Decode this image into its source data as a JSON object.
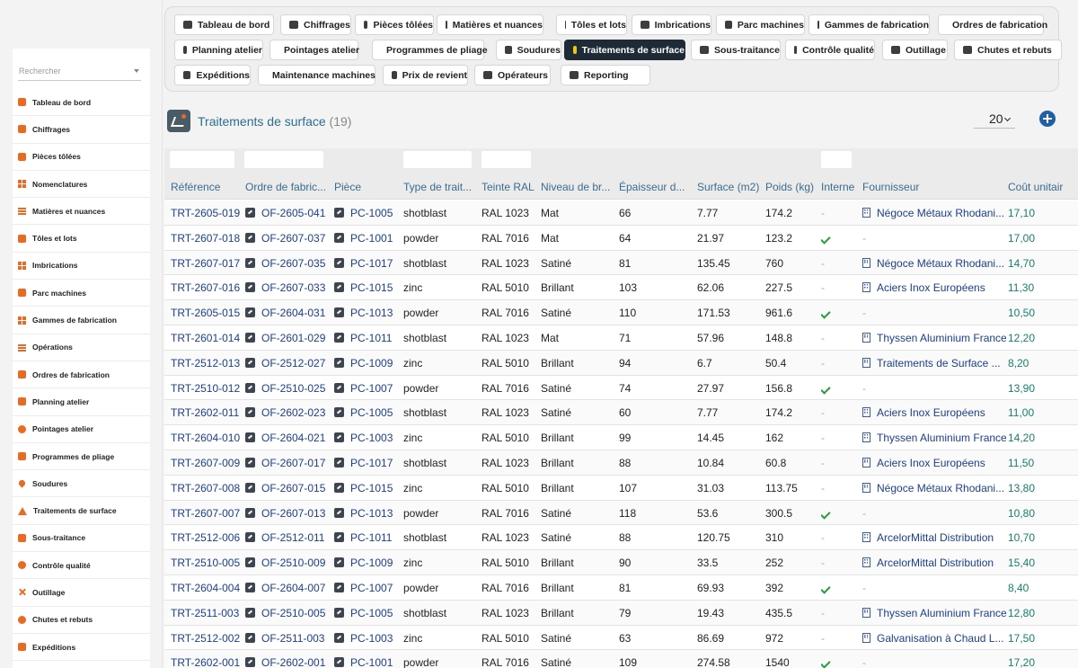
{
  "sidebar": {
    "search_placeholder": "Rechercher",
    "items": [
      {
        "label": "Tableau de bord",
        "icon": "dashboard-icon"
      },
      {
        "label": "Chiffrages",
        "icon": "calculator-icon"
      },
      {
        "label": "Pièces tôlées",
        "icon": "cube-icon"
      },
      {
        "label": "Nomenclatures",
        "icon": "sitemap-icon"
      },
      {
        "label": "Matières et nuances",
        "icon": "layers-icon"
      },
      {
        "label": "Tôles et lots",
        "icon": "stack-icon"
      },
      {
        "label": "Imbrications",
        "icon": "grid-icon"
      },
      {
        "label": "Parc machines",
        "icon": "factory-icon"
      },
      {
        "label": "Gammes de fabrication",
        "icon": "flow-icon"
      },
      {
        "label": "Opérations",
        "icon": "list-icon"
      },
      {
        "label": "Ordres de fabrication",
        "icon": "clipboard-icon"
      },
      {
        "label": "Planning atelier",
        "icon": "calendar-icon"
      },
      {
        "label": "Pointages atelier",
        "icon": "clock-icon"
      },
      {
        "label": "Programmes de pliage",
        "icon": "file-code-icon"
      },
      {
        "label": "Soudures",
        "icon": "flame-icon"
      },
      {
        "label": "Traitements de surface",
        "icon": "paint-roller-icon"
      },
      {
        "label": "Sous-traitance",
        "icon": "handshake-icon"
      },
      {
        "label": "Contrôle qualité",
        "icon": "badge-check-icon"
      },
      {
        "label": "Outillage",
        "icon": "tools-icon"
      },
      {
        "label": "Chutes et rebuts",
        "icon": "recycle-icon"
      },
      {
        "label": "Expéditions",
        "icon": "truck-icon"
      }
    ]
  },
  "tabs": [
    {
      "label": "Tableau de bord",
      "icon": "dashboard-icon",
      "active": false
    },
    {
      "label": "Chiffrages",
      "icon": "calculator-icon",
      "active": false
    },
    {
      "label": "Pièces tôlées",
      "icon": "cube-icon",
      "active": false
    },
    {
      "label": "Matières et nuances",
      "icon": "layers-icon",
      "active": false
    },
    {
      "label": "Tôles et lots",
      "icon": "stack-icon",
      "active": false
    },
    {
      "label": "Imbrications",
      "icon": "grid-icon",
      "active": false
    },
    {
      "label": "Parc machines",
      "icon": "factory-icon",
      "active": false
    },
    {
      "label": "Gammes de fabrication",
      "icon": "flow-icon",
      "active": false
    },
    {
      "label": "Ordres de fabrication",
      "icon": "clipboard-icon",
      "active": false
    },
    {
      "label": "Planning atelier",
      "icon": "calendar-icon",
      "active": false
    },
    {
      "label": "Pointages atelier",
      "icon": "clock-icon",
      "active": false
    },
    {
      "label": "Programmes de pliage",
      "icon": "file-code-icon",
      "active": false
    },
    {
      "label": "Soudures",
      "icon": "flame-icon",
      "active": false
    },
    {
      "label": "Traitements de surface",
      "icon": "paint-roller-icon",
      "active": true
    },
    {
      "label": "Sous-traitance",
      "icon": "handshake-icon",
      "active": false
    },
    {
      "label": "Contrôle qualité",
      "icon": "badge-check-icon",
      "active": false
    },
    {
      "label": "Outillage",
      "icon": "tools-icon",
      "active": false
    },
    {
      "label": "Chutes et rebuts",
      "icon": "recycle-icon",
      "active": false
    },
    {
      "label": "Expéditions",
      "icon": "truck-icon",
      "active": false
    },
    {
      "label": "Maintenance machines",
      "icon": "wrench-icon",
      "active": false
    },
    {
      "label": "Prix de revient",
      "icon": "receipt-icon",
      "active": false
    },
    {
      "label": "Opérateurs",
      "icon": "users-icon",
      "active": false
    },
    {
      "label": "Reporting",
      "icon": "chart-pie-icon",
      "active": false
    }
  ],
  "page": {
    "title": "Traitements de surface",
    "count": "(19)",
    "page_size": "20"
  },
  "table": {
    "columns": [
      "Référence",
      "Ordre de fabric...",
      "Pièce",
      "Type de trait...",
      "Teinte RAL",
      "Niveau de br...",
      "Épaisseur d...",
      "Surface (m2)",
      "Poids (kg)",
      "Interne",
      "Fournisseur",
      "Coût unitair"
    ],
    "rows": [
      {
        "ref": "TRT-2605-019",
        "of": "OF-2605-041",
        "piece": "PC-1005",
        "type": "shotblast",
        "ral": "RAL 1023",
        "niveau": "Mat",
        "ep": "66",
        "surface": "7.77",
        "poids": "174.2",
        "interne": false,
        "fournisseur": "Négoce Métaux Rhodani...",
        "cout": "17,10"
      },
      {
        "ref": "TRT-2607-018",
        "of": "OF-2607-037",
        "piece": "PC-1001",
        "type": "powder",
        "ral": "RAL 7016",
        "niveau": "Mat",
        "ep": "64",
        "surface": "21.97",
        "poids": "123.2",
        "interne": true,
        "fournisseur": "",
        "cout": "17,00"
      },
      {
        "ref": "TRT-2607-017",
        "of": "OF-2607-035",
        "piece": "PC-1017",
        "type": "shotblast",
        "ral": "RAL 1023",
        "niveau": "Satiné",
        "ep": "81",
        "surface": "135.45",
        "poids": "760",
        "interne": false,
        "fournisseur": "Négoce Métaux Rhodani...",
        "cout": "14,70"
      },
      {
        "ref": "TRT-2607-016",
        "of": "OF-2607-033",
        "piece": "PC-1015",
        "type": "zinc",
        "ral": "RAL 5010",
        "niveau": "Brillant",
        "ep": "103",
        "surface": "62.06",
        "poids": "227.5",
        "interne": false,
        "fournisseur": "Aciers Inox Européens",
        "cout": "11,30"
      },
      {
        "ref": "TRT-2605-015",
        "of": "OF-2604-031",
        "piece": "PC-1013",
        "type": "powder",
        "ral": "RAL 7016",
        "niveau": "Satiné",
        "ep": "110",
        "surface": "171.53",
        "poids": "961.6",
        "interne": true,
        "fournisseur": "",
        "cout": "10,50"
      },
      {
        "ref": "TRT-2601-014",
        "of": "OF-2601-029",
        "piece": "PC-1011",
        "type": "shotblast",
        "ral": "RAL 1023",
        "niveau": "Mat",
        "ep": "71",
        "surface": "57.96",
        "poids": "148.8",
        "interne": false,
        "fournisseur": "Thyssen Aluminium France",
        "cout": "12,20"
      },
      {
        "ref": "TRT-2512-013",
        "of": "OF-2512-027",
        "piece": "PC-1009",
        "type": "zinc",
        "ral": "RAL 5010",
        "niveau": "Brillant",
        "ep": "94",
        "surface": "6.7",
        "poids": "50.4",
        "interne": false,
        "fournisseur": "Traitements de Surface ...",
        "cout": "8,20"
      },
      {
        "ref": "TRT-2510-012",
        "of": "OF-2510-025",
        "piece": "PC-1007",
        "type": "powder",
        "ral": "RAL 7016",
        "niveau": "Satiné",
        "ep": "74",
        "surface": "27.97",
        "poids": "156.8",
        "interne": true,
        "fournisseur": "",
        "cout": "13,90"
      },
      {
        "ref": "TRT-2602-011",
        "of": "OF-2602-023",
        "piece": "PC-1005",
        "type": "shotblast",
        "ral": "RAL 1023",
        "niveau": "Satiné",
        "ep": "60",
        "surface": "7.77",
        "poids": "174.2",
        "interne": false,
        "fournisseur": "Aciers Inox Européens",
        "cout": "11,00"
      },
      {
        "ref": "TRT-2604-010",
        "of": "OF-2604-021",
        "piece": "PC-1003",
        "type": "zinc",
        "ral": "RAL 5010",
        "niveau": "Brillant",
        "ep": "99",
        "surface": "14.45",
        "poids": "162",
        "interne": false,
        "fournisseur": "Thyssen Aluminium France",
        "cout": "14,20"
      },
      {
        "ref": "TRT-2607-009",
        "of": "OF-2607-017",
        "piece": "PC-1017",
        "type": "shotblast",
        "ral": "RAL 1023",
        "niveau": "Brillant",
        "ep": "88",
        "surface": "10.84",
        "poids": "60.8",
        "interne": false,
        "fournisseur": "Aciers Inox Européens",
        "cout": "11,50"
      },
      {
        "ref": "TRT-2607-008",
        "of": "OF-2607-015",
        "piece": "PC-1015",
        "type": "zinc",
        "ral": "RAL 5010",
        "niveau": "Brillant",
        "ep": "107",
        "surface": "31.03",
        "poids": "113.75",
        "interne": false,
        "fournisseur": "Négoce Métaux Rhodani...",
        "cout": "13,80"
      },
      {
        "ref": "TRT-2607-007",
        "of": "OF-2607-013",
        "piece": "PC-1013",
        "type": "powder",
        "ral": "RAL 7016",
        "niveau": "Satiné",
        "ep": "118",
        "surface": "53.6",
        "poids": "300.5",
        "interne": true,
        "fournisseur": "",
        "cout": "10,80"
      },
      {
        "ref": "TRT-2512-006",
        "of": "OF-2512-011",
        "piece": "PC-1011",
        "type": "shotblast",
        "ral": "RAL 1023",
        "niveau": "Satiné",
        "ep": "88",
        "surface": "120.75",
        "poids": "310",
        "interne": false,
        "fournisseur": "ArcelorMittal Distribution",
        "cout": "10,70"
      },
      {
        "ref": "TRT-2510-005",
        "of": "OF-2510-009",
        "piece": "PC-1009",
        "type": "zinc",
        "ral": "RAL 5010",
        "niveau": "Brillant",
        "ep": "90",
        "surface": "33.5",
        "poids": "252",
        "interne": false,
        "fournisseur": "ArcelorMittal Distribution",
        "cout": "15,40"
      },
      {
        "ref": "TRT-2604-004",
        "of": "OF-2604-007",
        "piece": "PC-1007",
        "type": "powder",
        "ral": "RAL 7016",
        "niveau": "Brillant",
        "ep": "81",
        "surface": "69.93",
        "poids": "392",
        "interne": true,
        "fournisseur": "",
        "cout": "8,40"
      },
      {
        "ref": "TRT-2511-003",
        "of": "OF-2510-005",
        "piece": "PC-1005",
        "type": "shotblast",
        "ral": "RAL 1023",
        "niveau": "Brillant",
        "ep": "79",
        "surface": "19.43",
        "poids": "435.5",
        "interne": false,
        "fournisseur": "Thyssen Aluminium France",
        "cout": "12,80"
      },
      {
        "ref": "TRT-2512-002",
        "of": "OF-2511-003",
        "piece": "PC-1003",
        "type": "zinc",
        "ral": "RAL 5010",
        "niveau": "Satiné",
        "ep": "63",
        "surface": "86.69",
        "poids": "972",
        "interne": false,
        "fournisseur": "Galvanisation à Chaud L...",
        "cout": "17,50"
      },
      {
        "ref": "TRT-2602-001",
        "of": "OF-2602-001",
        "piece": "PC-1001",
        "type": "powder",
        "ral": "RAL 7016",
        "niveau": "Satiné",
        "ep": "109",
        "surface": "274.58",
        "poids": "1540",
        "interne": true,
        "fournisseur": "",
        "cout": "17,20"
      }
    ]
  },
  "colors": {
    "accent": "#e96a22",
    "active_tab": "#1e2a36",
    "link": "#1c3f8a",
    "cost": "#16806b",
    "check": "#2a9a3e"
  }
}
